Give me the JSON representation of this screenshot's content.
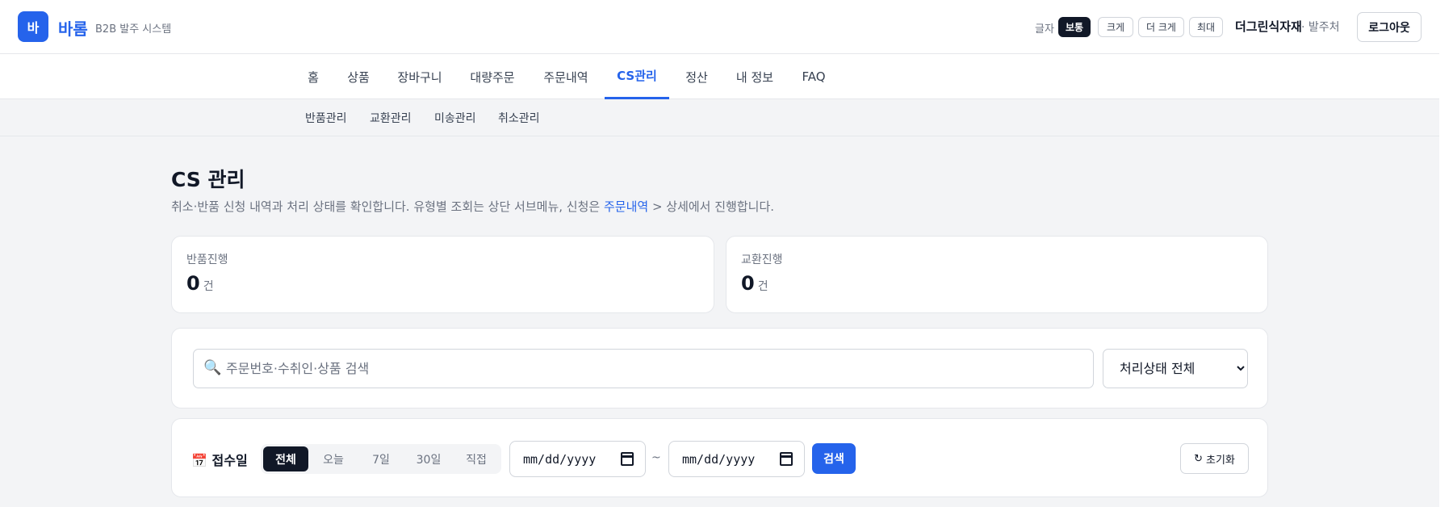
{
  "header": {
    "logo_char": "바",
    "brand": "바롬",
    "brand_sub": "B2B 발주 시스템",
    "font_label": "글자",
    "font_sizes": [
      "보통",
      "크게",
      "더 크게",
      "최대"
    ],
    "font_selected": "보통",
    "company": "더그린식자재",
    "role": "· 발주처",
    "logout": "로그아웃"
  },
  "nav": {
    "items": [
      "홈",
      "상품",
      "장바구니",
      "대량주문",
      "주문내역",
      "CS관리",
      "정산",
      "내 정보",
      "FAQ"
    ],
    "active": "CS관리"
  },
  "subnav": {
    "items": [
      "반품관리",
      "교환관리",
      "미송관리",
      "취소관리"
    ]
  },
  "main": {
    "title": "CS 관리",
    "desc_before": "취소·반품 신청 내역과 처리 상태를 확인합니다. 유형별 조회는 상단 서브메뉴, 신청은 ",
    "desc_link": "주문내역",
    "desc_after": " > 상세에서 진행합니다.",
    "stats": [
      {
        "label": "반품진행",
        "value": "0",
        "unit": "건"
      },
      {
        "label": "교환진행",
        "value": "0",
        "unit": "건"
      }
    ],
    "search": {
      "icon": "🔍",
      "placeholder": "주문번호·수취인·상품 검색",
      "value": "",
      "status_selected": "처리상태 전체"
    },
    "date_filter": {
      "icon": "📅",
      "label": "접수일",
      "ranges": [
        "전체",
        "오늘",
        "7일",
        "30일",
        "직접"
      ],
      "range_selected": "전체",
      "from_placeholder": "mm/dd/yyyy",
      "to_placeholder": "mm/dd/yyyy",
      "separator": "~",
      "search_label": "검색",
      "reset_icon": "↻",
      "reset_label": "초기화"
    }
  },
  "colors": {
    "accent": "#2563eb",
    "dark": "#111827",
    "muted": "#6b7280",
    "background": "#f3f4f6"
  }
}
